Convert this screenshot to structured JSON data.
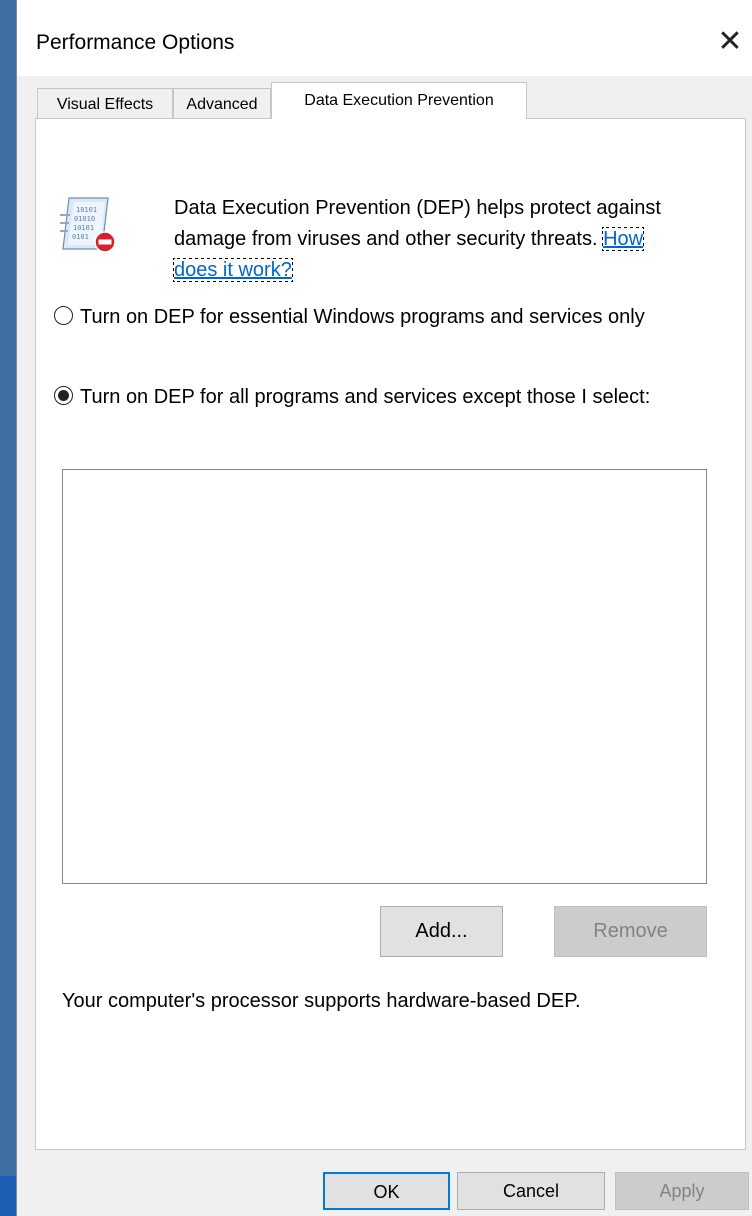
{
  "window": {
    "title": "Performance Options",
    "close_glyph": "✕"
  },
  "tabs": [
    {
      "label": "Visual Effects",
      "active": false
    },
    {
      "label": "Advanced",
      "active": false
    },
    {
      "label": "Data Execution Prevention",
      "active": true
    }
  ],
  "dep": {
    "icon": "dep-icon",
    "description": "Data Execution Prevention (DEP) helps protect against damage from viruses and other security threats.",
    "help_link": "How does it work?",
    "options": [
      {
        "label": "Turn on DEP for essential Windows programs and services only",
        "selected": false
      },
      {
        "label": "Turn on DEP for all programs and services except those I select:",
        "selected": true
      }
    ],
    "exceptions_list": [],
    "add_label": "Add...",
    "remove_label": "Remove",
    "remove_enabled": false,
    "status_text": "Your computer's processor supports hardware-based DEP."
  },
  "footer": {
    "ok_label": "OK",
    "cancel_label": "Cancel",
    "apply_label": "Apply",
    "apply_enabled": false
  },
  "colors": {
    "link": "#0066cc",
    "focus_border": "#0078d7",
    "desktop": "#3f6ea3"
  }
}
